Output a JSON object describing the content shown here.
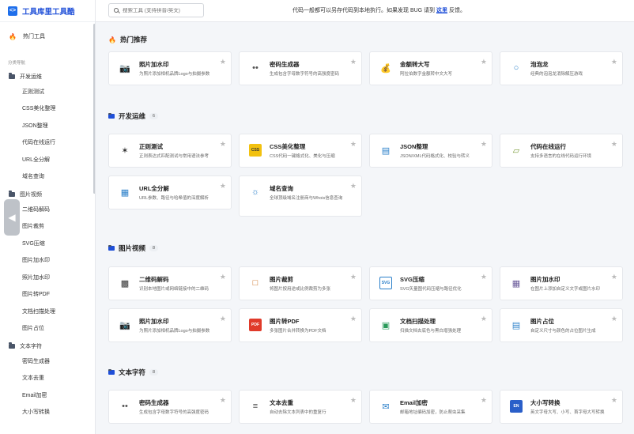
{
  "app": {
    "title": "工具库里工具酷",
    "logo_glyph": "<>"
  },
  "sidebar": {
    "hot_label": "热门工具",
    "category_title": "分类导航",
    "groups": [
      {
        "label": "开发运维",
        "items": [
          "正则测试",
          "CSS美化整理",
          "JSON整理",
          "代码在线运行",
          "URL全分解",
          "域名查询"
        ]
      },
      {
        "label": "图片视频",
        "items": [
          "二维码解码",
          "图片裁剪",
          "SVG压缩",
          "图片加水印",
          "照片加水印",
          "图片转PDF",
          "文档扫描处理",
          "图片占位"
        ]
      },
      {
        "label": "文本字符",
        "items": [
          "密码生成器",
          "文本去重",
          "Email加密",
          "大小写转换"
        ]
      }
    ]
  },
  "header": {
    "search_placeholder": "搜索工具 (支持拼音/英文)",
    "notice_prefix": "代码一般都可以另存代码到本地执行。如果发现 BUG 请到 ",
    "notice_link": "这里",
    "notice_suffix": " 反馈。"
  },
  "sections": [
    {
      "title": "热门推荐",
      "count": "",
      "cards": [
        {
          "title": "照片加水印",
          "desc": "为照片添加相机品牌Logo与拍摄参数",
          "icon": "camera-icon"
        },
        {
          "title": "密码生成器",
          "desc": "生成包含字母数字符号的高强度密码",
          "icon": "password-icon"
        },
        {
          "title": "金额转大写",
          "desc": "阿拉伯数字金额转中文大写",
          "icon": "money-bag-icon"
        },
        {
          "title": "泡泡龙",
          "desc": "经典的泡泡龙消除解压游戏",
          "icon": "bubble-icon"
        }
      ]
    },
    {
      "title": "开发运维",
      "count": "6",
      "cards": [
        {
          "title": "正则测试",
          "desc": "正则表达式匹配测试与常用语法参考",
          "icon": "regex-icon"
        },
        {
          "title": "CSS美化整理",
          "desc": "CSS代码一键格式化、美化与压缩",
          "icon": "css-icon"
        },
        {
          "title": "JSON整理",
          "desc": "JSON/XML代码格式化、校验与转义",
          "icon": "json-icon"
        },
        {
          "title": "代码在线运行",
          "desc": "支持多语言的在线代码运行环境",
          "icon": "code-run-icon"
        },
        {
          "title": "URL全分解",
          "desc": "URL参数、路径与哈希值的深度解析",
          "icon": "url-icon"
        },
        {
          "title": "域名查询",
          "desc": "全球顶级域名注册商与Whois信息查询",
          "icon": "domain-icon"
        }
      ]
    },
    {
      "title": "图片视频",
      "count": "8",
      "cards": [
        {
          "title": "二维码解码",
          "desc": "识别本地图片或网络链接中的二维码",
          "icon": "qrcode-icon"
        },
        {
          "title": "图片裁剪",
          "desc": "将图片按用途或比例裁剪为多张",
          "icon": "crop-icon"
        },
        {
          "title": "SVG压缩",
          "desc": "SVG矢量图代码压缩与路径优化",
          "icon": "svg-icon"
        },
        {
          "title": "图片加水印",
          "desc": "在图片上添加自定义文字或图片水印",
          "icon": "image-watermark-icon"
        },
        {
          "title": "照片加水印",
          "desc": "为照片添加相机品牌Logo与拍摄参数",
          "icon": "camera-icon"
        },
        {
          "title": "图片转PDF",
          "desc": "多张图片合并转换为PDF文档",
          "icon": "pdf-icon"
        },
        {
          "title": "文档扫描处理",
          "desc": "扫描文档去底色与黑白增强处理",
          "icon": "scan-icon"
        },
        {
          "title": "图片占位",
          "desc": "自定义尺寸与颜色的占位图片生成",
          "icon": "placeholder-icon"
        }
      ]
    },
    {
      "title": "文本字符",
      "count": "8",
      "cards": [
        {
          "title": "密码生成器",
          "desc": "生成包含字母数字符号的高强度密码",
          "icon": "password-icon"
        },
        {
          "title": "文本去重",
          "desc": "自动去除文本列表中的重复行",
          "icon": "dedupe-icon"
        },
        {
          "title": "Email加密",
          "desc": "邮箱地址编码加密，防止爬虫采集",
          "icon": "email-icon"
        },
        {
          "title": "大小写转换",
          "desc": "英文字母大写、小写、首字母大写转换",
          "icon": "case-convert-icon"
        }
      ]
    }
  ],
  "colors": {
    "accent": "#1f4fd8",
    "hot": "#f05a28",
    "background": "#f4f6f9"
  }
}
